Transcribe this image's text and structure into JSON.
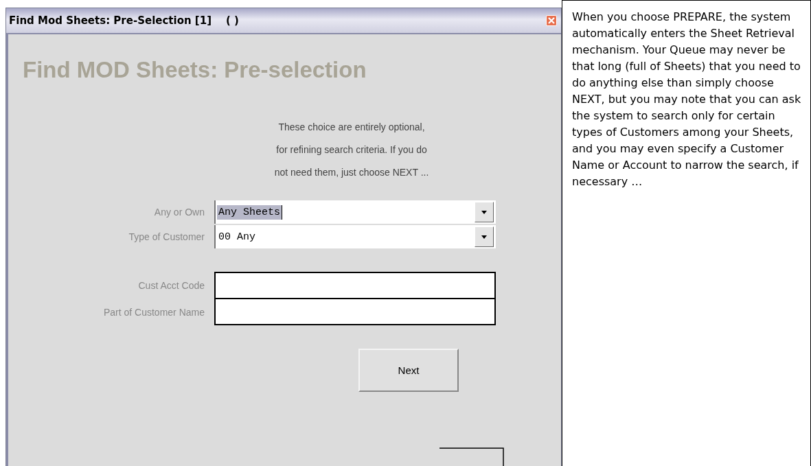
{
  "window": {
    "title": "Find Mod Sheets: Pre-Selection [1]    ( )"
  },
  "heading": "Find MOD Sheets: Pre-selection",
  "intro_lines": [
    "These choice are entirely optional,",
    "for refining search criteria. If you do",
    "not need them, just choose NEXT ..."
  ],
  "dropdowns": [
    {
      "label": "Any or Own",
      "value": "Any Sheets",
      "highlighted": true
    },
    {
      "label": "Type of Customer",
      "value": "00 Any",
      "highlighted": false
    }
  ],
  "text_fields": [
    {
      "label": "Cust Acct Code"
    },
    {
      "label": "Part of Customer Name"
    }
  ],
  "buttons": [
    "Next"
  ],
  "note": "When you choose PREPARE, the system automatically enters the Sheet Retrieval mechanism. Your Queue may never be that long (full of Sheets) that you need to do anything else than simply choose NEXT, but you may note that you can ask the system to search only for certain types of Customers among your Sheets, and you may even specify a Customer Name or Account to narrow the search, if necessary …"
}
